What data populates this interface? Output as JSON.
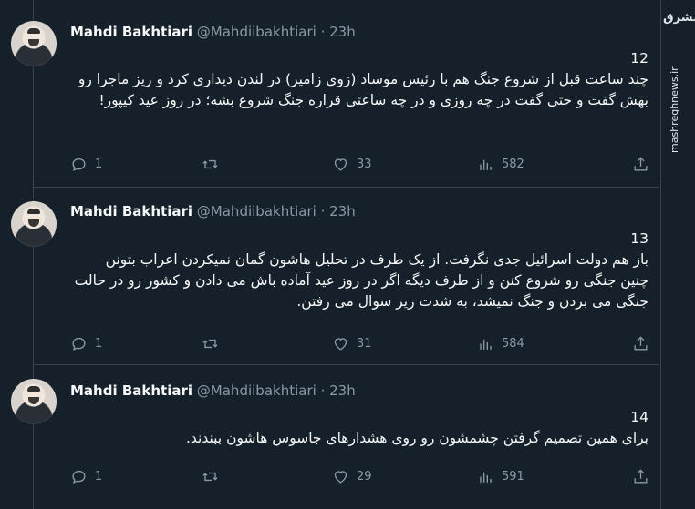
{
  "watermark": {
    "logo_text": "مشرق",
    "site": "mashreghnews.ir"
  },
  "tweets": [
    {
      "name": "Mahdi Bakhtiari",
      "handle": "@Mahdiibakhtiari",
      "separator": "·",
      "time": "23h",
      "number": "12",
      "text": "چند ساعت قبل از شروع جنگ هم با رئیس موساد (زوی زامیر) در لندن دیداری کرد و ریز ماجرا رو بهش گفت و حتی گفت در چه روزی و در چه ساعتی قراره جنگ شروع بشه؛ در روز عید کیپور!",
      "replies": "1",
      "retweets": "",
      "likes": "33",
      "views": "582"
    },
    {
      "name": "Mahdi Bakhtiari",
      "handle": "@Mahdiibakhtiari",
      "separator": "·",
      "time": "23h",
      "number": "13",
      "text": "باز هم دولت اسرائیل جدی نگرفت. از یک طرف در تحلیل هاشون گمان نمیکردن اعراب بتونن چنین جنگی رو شروع کنن و از طرف دیگه اگر در روز عید آماده باش می دادن و کشور رو در حالت جنگی می بردن و جنگ نمیشد، به شدت زیر سوال می رفتن.",
      "replies": "1",
      "retweets": "",
      "likes": "31",
      "views": "584"
    },
    {
      "name": "Mahdi Bakhtiari",
      "handle": "@Mahdiibakhtiari",
      "separator": "·",
      "time": "23h",
      "number": "14",
      "text": "برای همین تصمیم گرفتن چشمشون رو روی هشدارهای جاسوس هاشون ببندند.",
      "replies": "1",
      "retweets": "",
      "likes": "29",
      "views": "591"
    }
  ]
}
